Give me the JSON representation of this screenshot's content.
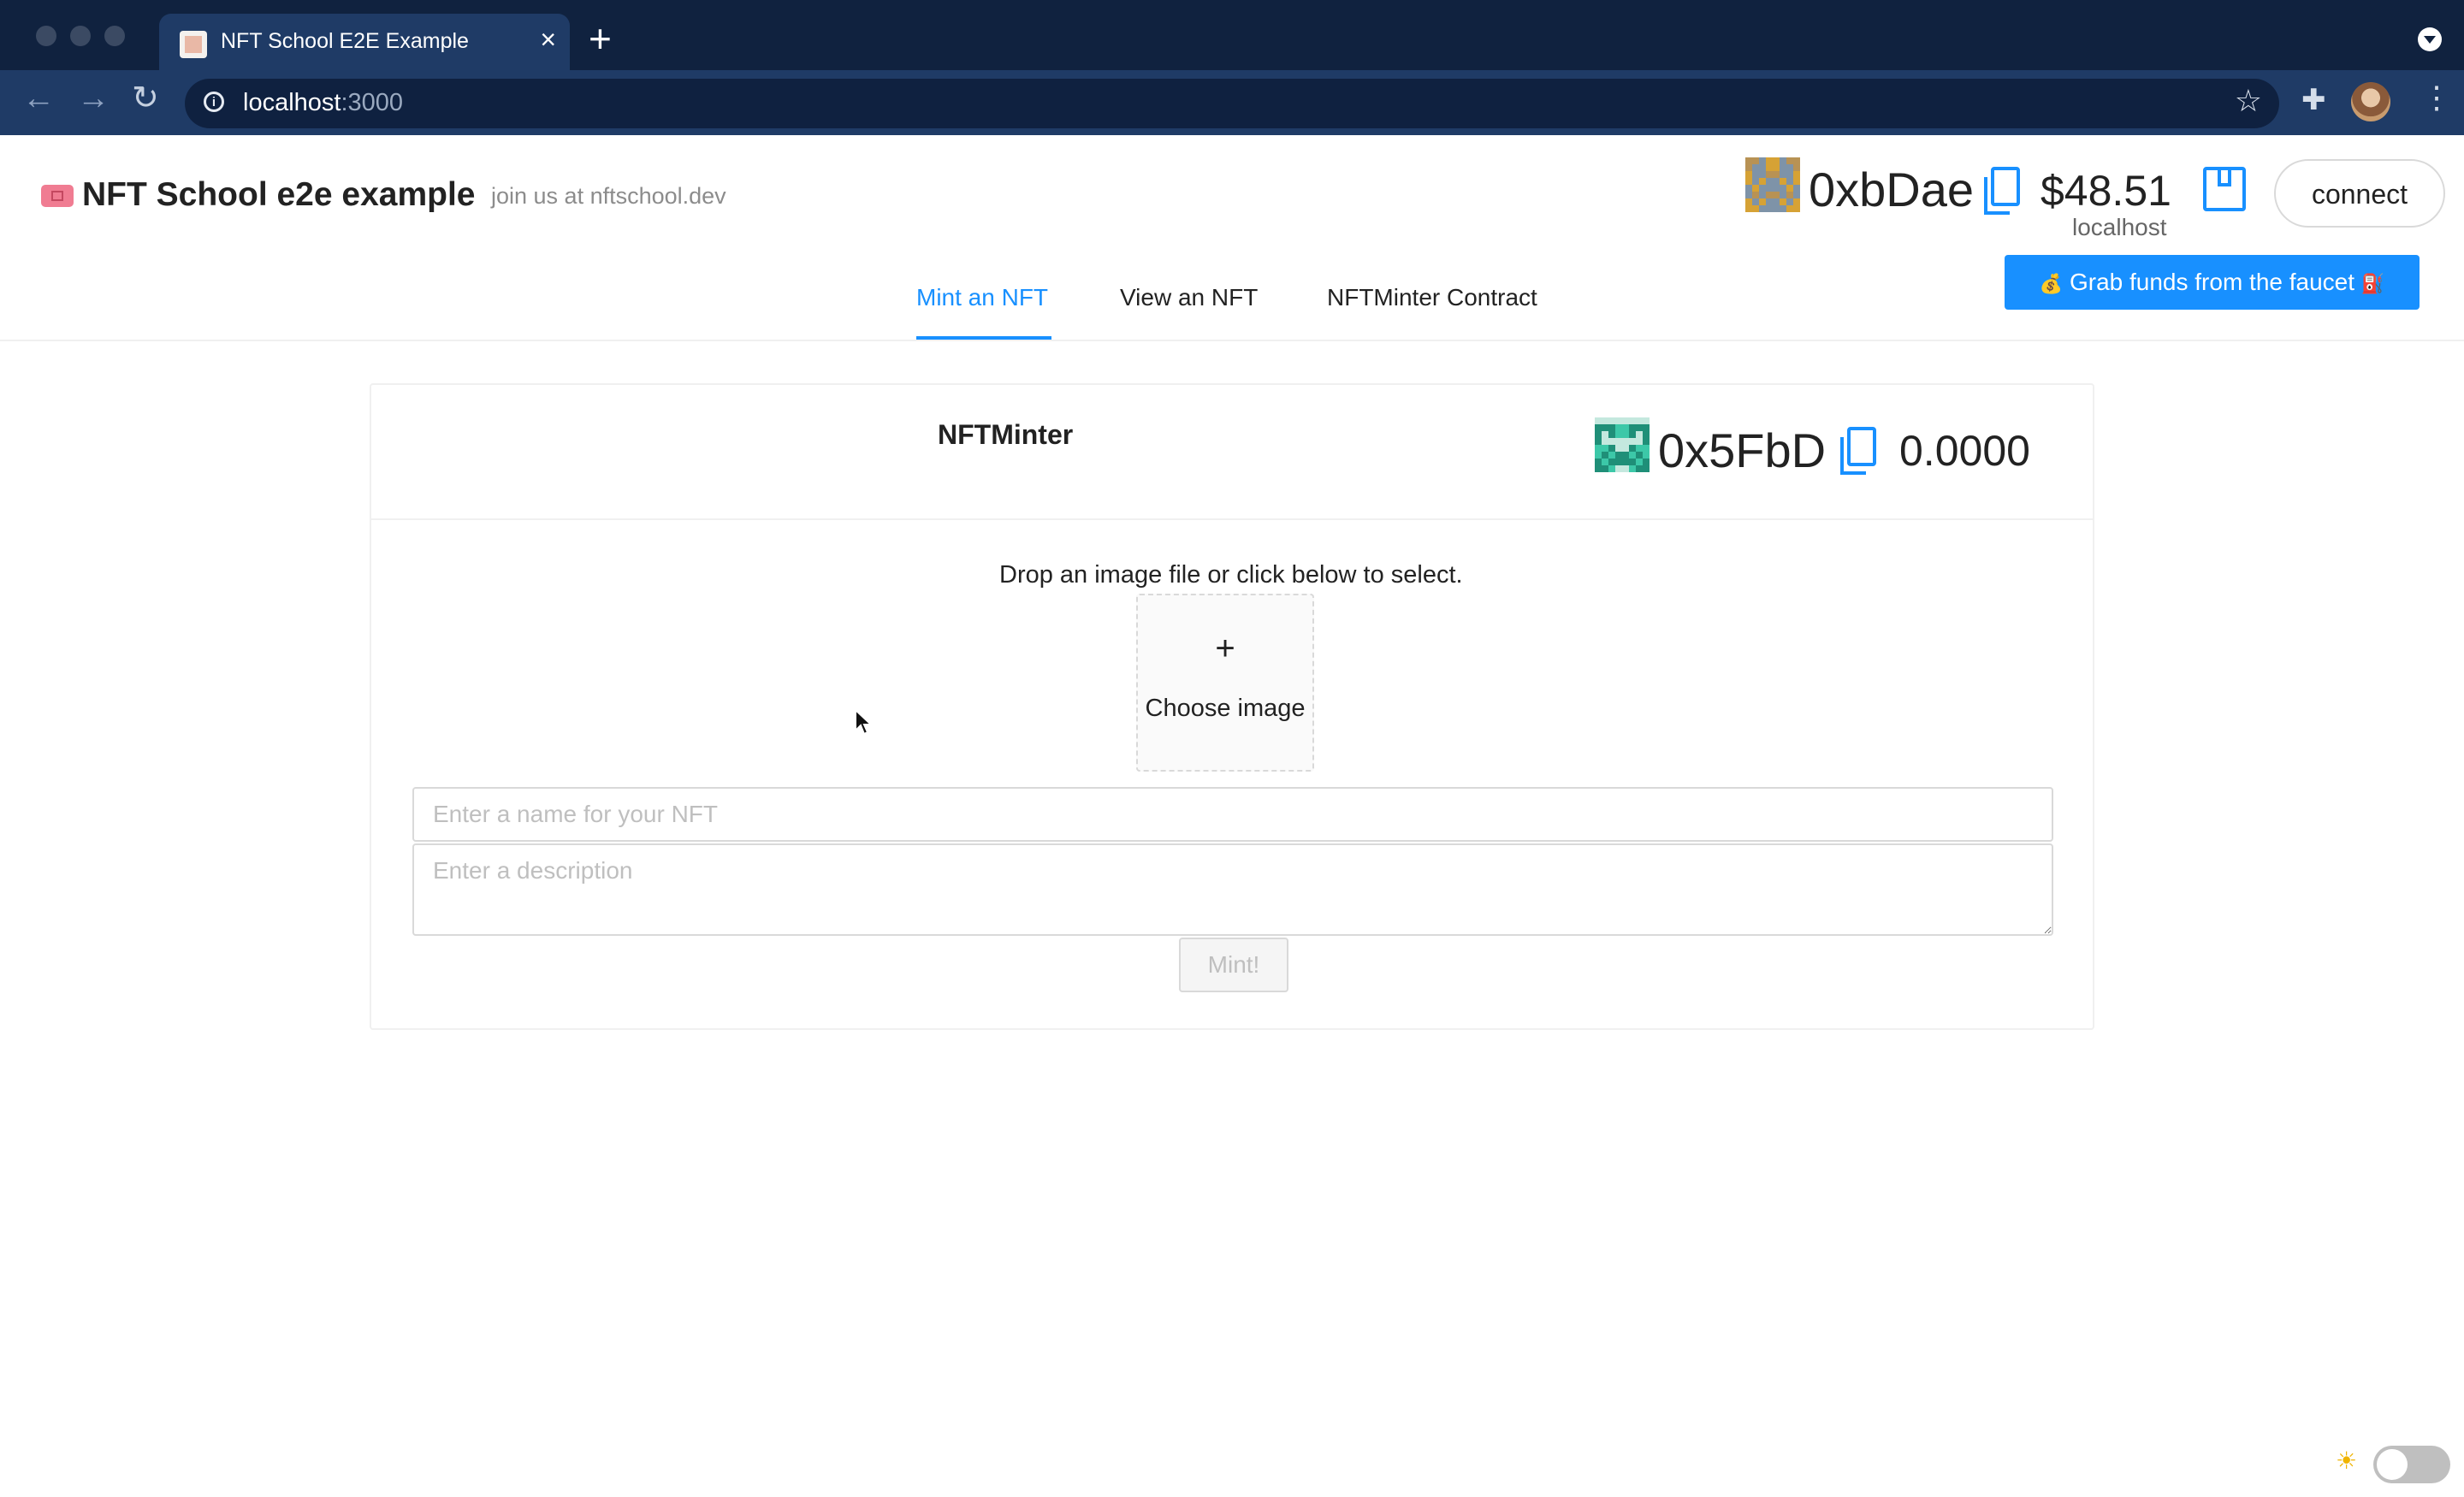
{
  "browser": {
    "tab_title": "NFT School E2E Example",
    "tab_close": "×",
    "new_tab": "+",
    "url_host": "localhost",
    "url_port": ":3000",
    "nav": {
      "back": "←",
      "forward": "→",
      "reload": "↻"
    },
    "star": "☆",
    "extensions": "✚",
    "menu": "⋮"
  },
  "header": {
    "title": "NFT School e2e example",
    "subtitle": "join us at nftschool.dev",
    "account": {
      "address": "0xbDae",
      "balance": "$48.51",
      "network": "localhost"
    },
    "connect_label": "connect",
    "faucet": {
      "prefix_emoji": "💰",
      "label": "Grab funds from the faucet",
      "suffix_emoji": "⛽"
    }
  },
  "menu": {
    "items": [
      "Mint an NFT",
      "View an NFT",
      "NFTMinter Contract"
    ],
    "active": "Mint an NFT"
  },
  "card": {
    "title": "NFTMinter",
    "contract": {
      "address": "0x5FbD",
      "balance": "0.0000"
    },
    "drop_text": "Drop an image file or click below to select.",
    "upload": {
      "plus": "+",
      "label": "Choose image"
    },
    "name_placeholder": "Enter a name for your NFT",
    "description_placeholder": "Enter a description",
    "mint_label": "Mint!"
  },
  "theme": {
    "sun": "☀"
  },
  "colors": {
    "accent": "#1890ff",
    "tab_bar": "#10223f",
    "toolbar": "#1f3b66",
    "brand_icon": "#f07c92"
  }
}
